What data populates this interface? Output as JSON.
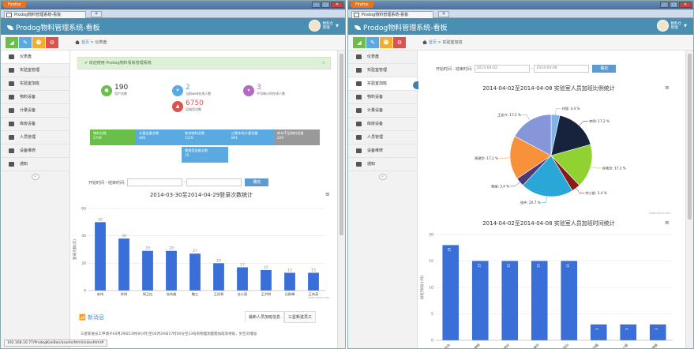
{
  "browser": {
    "app_button": "Firefox",
    "tab_title": "Prodog物料管理系统-看板",
    "new_tab": "+",
    "window_controls": [
      "–",
      "□",
      "✕"
    ]
  },
  "app": {
    "brand": "Prodog物料管理系统-看板",
    "user_name": "物料仓",
    "user_role": "管理"
  },
  "sidebar": {
    "items": [
      {
        "label": "仪表盘",
        "icon": "dashboard-icon"
      },
      {
        "label": "实验室管理",
        "icon": "lab-icon"
      },
      {
        "label": "实验室加班",
        "icon": "overtime-icon"
      },
      {
        "label": "物料设备",
        "icon": "monitor-icon"
      },
      {
        "label": "计量设备",
        "icon": "list-icon"
      },
      {
        "label": "库房设备",
        "icon": "list-icon"
      },
      {
        "label": "人员管理",
        "icon": "calendar-icon"
      },
      {
        "label": "设备维修",
        "icon": "tag-icon"
      },
      {
        "label": "通知",
        "icon": "document-icon"
      }
    ]
  },
  "left": {
    "breadcrumb": {
      "home": "首页",
      "current": "仪表盘"
    },
    "alert": "欢迎使用 Prodog物料看板管理系统",
    "alert_close": "×",
    "stats": [
      {
        "value": "190",
        "label": "用户总数",
        "icon": "chat-icon",
        "color": "#6abf4b"
      },
      {
        "value": "2",
        "label": "当前web在线人数",
        "icon": "twitter-icon",
        "color": "#5aa9e0"
      },
      {
        "value": "3",
        "label": "平均每小时在线人数",
        "icon": "cart-icon",
        "color": "#b36ac2"
      },
      {
        "value": "6750",
        "label": "总借用次数",
        "icon": "flask-icon",
        "color": "#d9534f"
      }
    ],
    "tiles": [
      {
        "title": "物料总数",
        "value": "2709",
        "color": "#6abf4b"
      },
      {
        "title": "计量设备总数",
        "value": "406",
        "color": "#5aa9e0"
      },
      {
        "title": "耗材物料总数",
        "value": "1119",
        "color": "#5aa9e0"
      },
      {
        "title": "过期未检计量设备",
        "value": "891",
        "color": "#5aa9e0"
      },
      {
        "title": "库存不足物料设备",
        "value": "229",
        "color": "#999999"
      },
      {
        "title": "需借用设备总数",
        "value": "15",
        "color": "#5aa9e0"
      }
    ],
    "date_label": "开始时间 - 结束时间:",
    "date_sep": "-",
    "query_btn": "确定",
    "chart_title": "2014-03-30至2014-04-29登录次数统计",
    "credit": "Highcharts.com",
    "news_title": "新消息",
    "news_tabs": [
      "最新人员加班信息",
      "三星新进员工"
    ],
    "news_line": "三星新进员工申请于04月29日13时(8小时)至04月29日17时00分至23号有物理测量需加班等待处，另告刘增加",
    "status_url": "192.168.10.77/ProdogKanBan/assets/html/indexhtml#"
  },
  "right": {
    "breadcrumb": {
      "home": "首页",
      "current": "实验室加班"
    },
    "date_label": "开始时间 - 结束时间:",
    "date_start": "2014-04-02",
    "date_sep": "-",
    "date_end": "2014-04-08",
    "query_btn": "确定",
    "pie_title": "2014-04-02至2014-04-08 实验室人员加班比例统计",
    "bar_title": "2014-04-02至2014-04-08 实验室人员加班时间统计",
    "credit": "Highcharts.com"
  },
  "chart_data": [
    {
      "type": "bar",
      "title": "2014-03-30至2014-04-29登录次数统计",
      "ylabel": "登录次数(次)",
      "categories": [
        "宋伟",
        "徐明",
        "周卫红",
        "张伟路",
        "魏三",
        "王凤翠",
        "苏小丽",
        "王洪明",
        "吕群峰",
        "王伟英"
      ],
      "values": [
        50,
        38,
        29,
        29,
        27,
        20,
        17,
        15,
        13,
        13
      ],
      "ylim": [
        0,
        60
      ],
      "yticks": [
        0,
        20,
        40,
        60
      ],
      "color": "#3a6fd8"
    },
    {
      "type": "pie",
      "title": "2014-04-02至2014-04-08 实验室人员加班比例统计",
      "slices": [
        {
          "label": "刘强",
          "value": 3.4,
          "color": "#7cb5ec"
        },
        {
          "label": "李明",
          "value": 17.2,
          "color": "#16233a"
        },
        {
          "label": "徐艳玲",
          "value": 17.2,
          "color": "#90d232"
        },
        {
          "label": "余小姐",
          "value": 3.4,
          "color": "#8b1a1a"
        },
        {
          "label": "张卉",
          "value": 20.7,
          "color": "#2aa7d6"
        },
        {
          "label": "杨丽",
          "value": 3.4,
          "color": "#4b3a7a"
        },
        {
          "label": "周建华",
          "value": 17.2,
          "color": "#f7923a"
        },
        {
          "label": "王佳兴",
          "value": 17.2,
          "color": "#8795d9"
        }
      ]
    },
    {
      "type": "bar",
      "title": "2014-04-02至2014-04-08 实验室人员加班时间统计",
      "ylabel": "加班时间(小时)",
      "categories": [
        "张卉",
        "李明",
        "徐艳玲",
        "周建华",
        "王佳兴",
        "刘强",
        "余小姐",
        "杨丽"
      ],
      "values": [
        18,
        15,
        15,
        15,
        15,
        3,
        3,
        3
      ],
      "ylim": [
        0,
        20
      ],
      "yticks": [
        0,
        5,
        10,
        15,
        20
      ],
      "color": "#3a6fd8"
    }
  ]
}
